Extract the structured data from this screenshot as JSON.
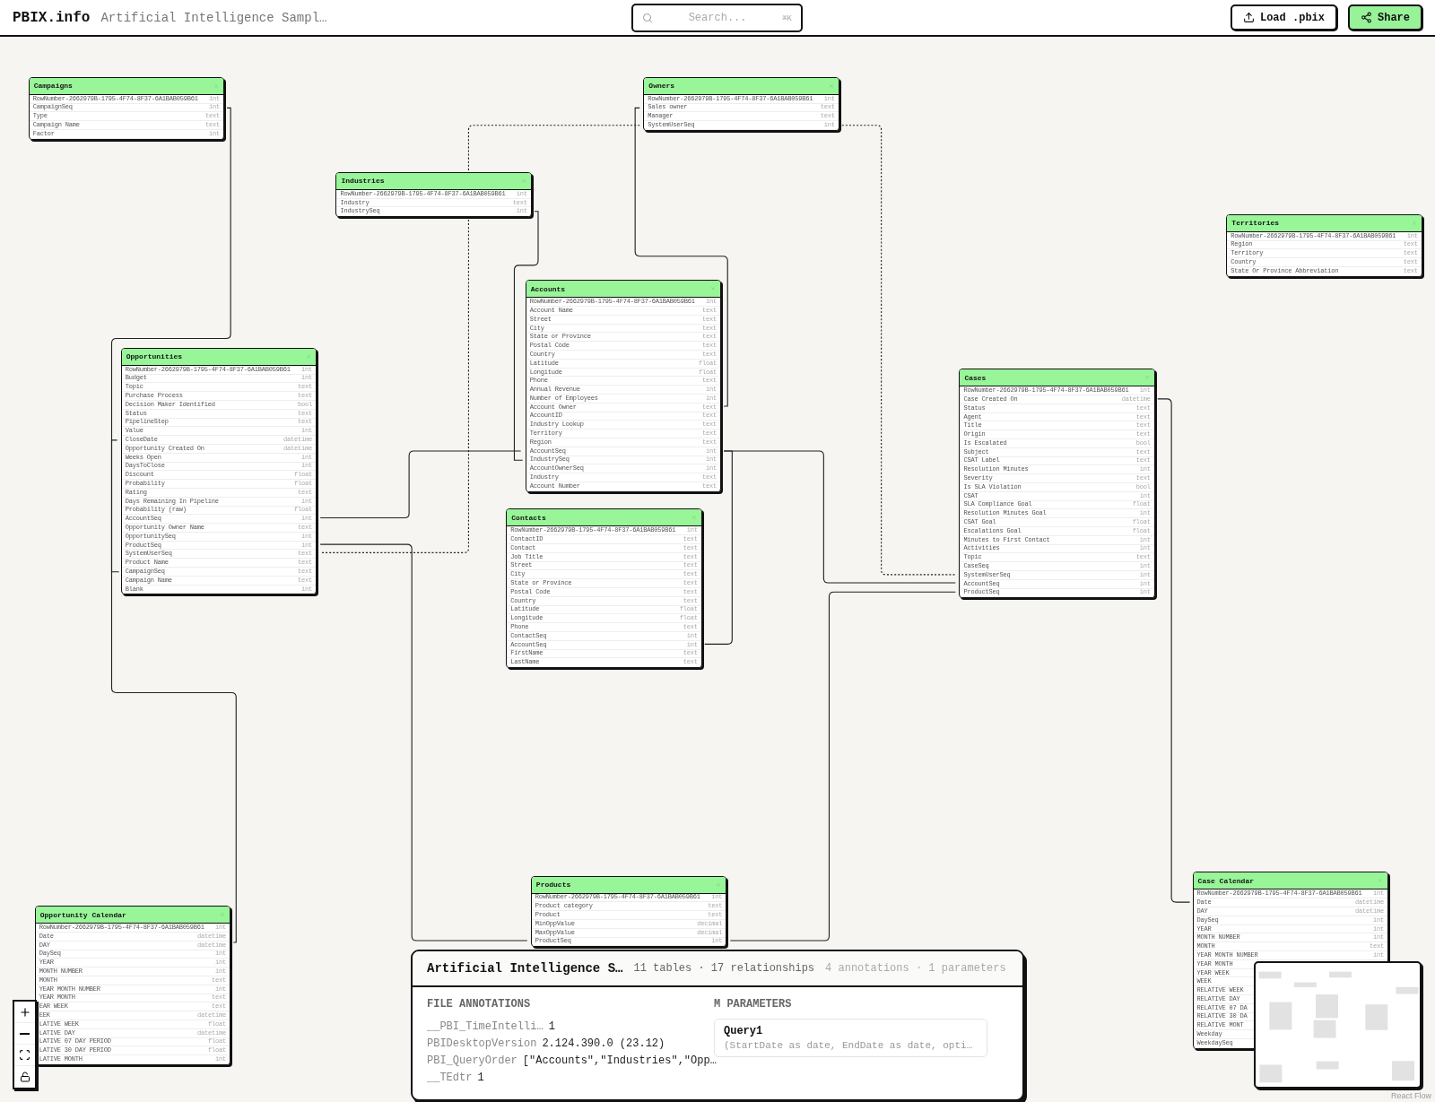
{
  "header": {
    "logo": "PBIX.info",
    "subtitle": "Artificial Intelligence Sampl…",
    "search": {
      "placeholder": "Search...",
      "shortcut": "⌘K"
    },
    "buttons": [
      {
        "label": "Load .pbix",
        "kind": "upload"
      },
      {
        "label": "Share",
        "kind": "share"
      }
    ]
  },
  "tables": [
    {
      "name": "Campaigns",
      "columns": [
        {
          "name": "RowNumber-2662979B-1795-4F74-8F37-6A1BAB059B61",
          "type": "int"
        },
        {
          "name": "CampaignSeq",
          "type": "int"
        },
        {
          "name": "Type",
          "type": "text"
        },
        {
          "name": "Campaign Name",
          "type": "text"
        },
        {
          "name": "Factor",
          "type": "int"
        }
      ]
    },
    {
      "name": "Owners",
      "columns": [
        {
          "name": "RowNumber-2662979B-1795-4F74-8F37-6A1BAB059B61",
          "type": "int"
        },
        {
          "name": "Sales owner",
          "type": "text"
        },
        {
          "name": "Manager",
          "type": "text"
        },
        {
          "name": "SystemUserSeq",
          "type": "int"
        }
      ]
    },
    {
      "name": "Industries",
      "columns": [
        {
          "name": "RowNumber-2662979B-1795-4F74-8F37-6A1BAB059B61",
          "type": "int"
        },
        {
          "name": "Industry",
          "type": "text"
        },
        {
          "name": "IndustrySeq",
          "type": "int"
        }
      ]
    },
    {
      "name": "Territories",
      "columns": [
        {
          "name": "RowNumber-2662979B-1795-4F74-8F37-6A1BAB059B61",
          "type": "int"
        },
        {
          "name": "Region",
          "type": "text"
        },
        {
          "name": "Territory",
          "type": "text"
        },
        {
          "name": "Country",
          "type": "text"
        },
        {
          "name": "State Or Province Abbreviation",
          "type": "text"
        }
      ]
    },
    {
      "name": "Accounts",
      "columns": [
        {
          "name": "RowNumber-2662979B-1795-4F74-8F37-6A1BAB059B61",
          "type": "int"
        },
        {
          "name": "Account Name",
          "type": "text"
        },
        {
          "name": "Street",
          "type": "text"
        },
        {
          "name": "City",
          "type": "text"
        },
        {
          "name": "State or Province",
          "type": "text"
        },
        {
          "name": "Postal Code",
          "type": "text"
        },
        {
          "name": "Country",
          "type": "text"
        },
        {
          "name": "Latitude",
          "type": "float"
        },
        {
          "name": "Longitude",
          "type": "float"
        },
        {
          "name": "Phone",
          "type": "text"
        },
        {
          "name": "Annual Revenue",
          "type": "int"
        },
        {
          "name": "Number of Employees",
          "type": "int"
        },
        {
          "name": "Account Owner",
          "type": "text"
        },
        {
          "name": "AccountID",
          "type": "text"
        },
        {
          "name": "Industry Lookup",
          "type": "text"
        },
        {
          "name": "Territory",
          "type": "text"
        },
        {
          "name": "Region",
          "type": "text"
        },
        {
          "name": "AccountSeq",
          "type": "int"
        },
        {
          "name": "IndustrySeq",
          "type": "int"
        },
        {
          "name": "AccountOwnerSeq",
          "type": "int"
        },
        {
          "name": "Industry",
          "type": "text"
        },
        {
          "name": "Account Number",
          "type": "text"
        }
      ]
    },
    {
      "name": "Opportunities",
      "columns": [
        {
          "name": "RowNumber-2662979B-1795-4F74-8F37-6A1BAB059B61",
          "type": "int"
        },
        {
          "name": "Budget",
          "type": "int"
        },
        {
          "name": "Topic",
          "type": "text"
        },
        {
          "name": "Purchase Process",
          "type": "text"
        },
        {
          "name": "Decision Maker Identified",
          "type": "bool"
        },
        {
          "name": "Status",
          "type": "text"
        },
        {
          "name": "PipelineStep",
          "type": "text"
        },
        {
          "name": "Value",
          "type": "int"
        },
        {
          "name": "CloseDate",
          "type": "datetime"
        },
        {
          "name": "Opportunity Created On",
          "type": "datetime"
        },
        {
          "name": "Weeks Open",
          "type": "int"
        },
        {
          "name": "DaysToClose",
          "type": "int"
        },
        {
          "name": "Discount",
          "type": "float"
        },
        {
          "name": "Probability",
          "type": "float"
        },
        {
          "name": "Rating",
          "type": "text"
        },
        {
          "name": "Days Remaining In Pipeline",
          "type": "int"
        },
        {
          "name": "Probability (raw)",
          "type": "float"
        },
        {
          "name": "AccountSeq",
          "type": "int"
        },
        {
          "name": "Opportunity Owner Name",
          "type": "text"
        },
        {
          "name": "OpportunitySeq",
          "type": "int"
        },
        {
          "name": "ProductSeq",
          "type": "int"
        },
        {
          "name": "SystemUserSeq",
          "type": "text"
        },
        {
          "name": "Product Name",
          "type": "text"
        },
        {
          "name": "CampaignSeq",
          "type": "text"
        },
        {
          "name": "Campaign Name",
          "type": "text"
        },
        {
          "name": "Blank",
          "type": "int"
        }
      ]
    },
    {
      "name": "Cases",
      "columns": [
        {
          "name": "RowNumber-2662979B-1795-4F74-8F37-6A1BAB059B61",
          "type": "int"
        },
        {
          "name": "Case Created On",
          "type": "datetime"
        },
        {
          "name": "Status",
          "type": "text"
        },
        {
          "name": "Agent",
          "type": "text"
        },
        {
          "name": "Title",
          "type": "text"
        },
        {
          "name": "Origin",
          "type": "text"
        },
        {
          "name": "Is Escalated",
          "type": "bool"
        },
        {
          "name": "Subject",
          "type": "text"
        },
        {
          "name": "CSAT Label",
          "type": "text"
        },
        {
          "name": "Resolution Minutes",
          "type": "int"
        },
        {
          "name": "Severity",
          "type": "text"
        },
        {
          "name": "Is SLA Violation",
          "type": "bool"
        },
        {
          "name": "CSAT",
          "type": "int"
        },
        {
          "name": "SLA Compliance Goal",
          "type": "float"
        },
        {
          "name": "Resolution Minutes Goal",
          "type": "int"
        },
        {
          "name": "CSAT Goal",
          "type": "float"
        },
        {
          "name": "Escalations Goal",
          "type": "float"
        },
        {
          "name": "Minutes to First Contact",
          "type": "int"
        },
        {
          "name": "Activities",
          "type": "int"
        },
        {
          "name": "Topic",
          "type": "text"
        },
        {
          "name": "CaseSeq",
          "type": "int"
        },
        {
          "name": "SystemUserSeq",
          "type": "int"
        },
        {
          "name": "AccountSeq",
          "type": "int"
        },
        {
          "name": "ProductSeq",
          "type": "int"
        }
      ]
    },
    {
      "name": "Contacts",
      "columns": [
        {
          "name": "RowNumber-2662979B-1795-4F74-8F37-6A1BAB059B61",
          "type": "int"
        },
        {
          "name": "ContactID",
          "type": "text"
        },
        {
          "name": "Contact",
          "type": "text"
        },
        {
          "name": "Job Title",
          "type": "text"
        },
        {
          "name": "Street",
          "type": "text"
        },
        {
          "name": "City",
          "type": "text"
        },
        {
          "name": "State or Province",
          "type": "text"
        },
        {
          "name": "Postal Code",
          "type": "text"
        },
        {
          "name": "Country",
          "type": "text"
        },
        {
          "name": "Latitude",
          "type": "float"
        },
        {
          "name": "Longitude",
          "type": "float"
        },
        {
          "name": "Phone",
          "type": "text"
        },
        {
          "name": "ContactSeq",
          "type": "int"
        },
        {
          "name": "AccountSeq",
          "type": "int"
        },
        {
          "name": "FirstName",
          "type": "text"
        },
        {
          "name": "LastName",
          "type": "text"
        }
      ]
    },
    {
      "name": "Products",
      "columns": [
        {
          "name": "RowNumber-2662979B-1795-4F74-8F37-6A1BAB059B61",
          "type": "int"
        },
        {
          "name": "Product category",
          "type": "text"
        },
        {
          "name": "Product",
          "type": "text"
        },
        {
          "name": "MinOppValue",
          "type": "decimal"
        },
        {
          "name": "MaxOppValue",
          "type": "decimal"
        },
        {
          "name": "ProductSeq",
          "type": "int"
        }
      ]
    },
    {
      "name": "Opportunity Calendar",
      "columns": [
        {
          "name": "RowNumber-2662979B-1795-4F74-8F37-6A1BAB059B61",
          "type": "int"
        },
        {
          "name": "Date",
          "type": "datetime"
        },
        {
          "name": "DAY",
          "type": "datetime"
        },
        {
          "name": "DaySeq",
          "type": "int"
        },
        {
          "name": "YEAR",
          "type": "int"
        },
        {
          "name": "MONTH NUMBER",
          "type": "int"
        },
        {
          "name": "MONTH",
          "type": "text"
        },
        {
          "name": "YEAR MONTH NUMBER",
          "type": "int"
        },
        {
          "name": "YEAR MONTH",
          "type": "text"
        },
        {
          "name": "EAR WEEK",
          "type": "text"
        },
        {
          "name": "EEK",
          "type": "datetime"
        },
        {
          "name": "LATIVE WEEK",
          "type": "float"
        },
        {
          "name": "LATIVE DAY",
          "type": "datetime"
        },
        {
          "name": "LATIVE 07 DAY PERIOD",
          "type": "float"
        },
        {
          "name": "LATIVE 30 DAY PERIOD",
          "type": "float"
        },
        {
          "name": "LATIVE MONTH",
          "type": "int"
        }
      ]
    },
    {
      "name": "Case Calendar",
      "columns": [
        {
          "name": "RowNumber-2662979B-1795-4F74-8F37-6A1BAB059B61",
          "type": "int"
        },
        {
          "name": "Date",
          "type": "datetime"
        },
        {
          "name": "DAY",
          "type": "datetime"
        },
        {
          "name": "DaySeq",
          "type": "int"
        },
        {
          "name": "YEAR",
          "type": "int"
        },
        {
          "name": "MONTH NUMBER",
          "type": "int"
        },
        {
          "name": "MONTH",
          "type": "text"
        },
        {
          "name": "YEAR MONTH NUMBER",
          "type": "int"
        },
        {
          "name": "YEAR MONTH"
        },
        {
          "name": "YEAR WEEK"
        },
        {
          "name": "WEEK"
        },
        {
          "name": "RELATIVE WEEK"
        },
        {
          "name": "RELATIVE DAY"
        },
        {
          "name": "RELATIVE 07 DA"
        },
        {
          "name": "RELATIVE 30 DA"
        },
        {
          "name": "RELATIVE MONT"
        },
        {
          "name": "Weekday"
        },
        {
          "name": "WeekdaySeq"
        }
      ]
    }
  ],
  "summary": {
    "title": "Artificial Intelligence S…",
    "stats": "11 tables · 17 relationships",
    "stats_muted": "4 annotations · 1 parameters",
    "annotations_heading": "FILE ANNOTATIONS",
    "annotations": [
      {
        "key": "__PBI_TimeIntelli…",
        "value": "1"
      },
      {
        "key": "PBIDesktopVersion",
        "value": "2.124.390.0 (23.12)"
      },
      {
        "key": "PBI_QueryOrder",
        "value": "[\"Accounts\",\"Industries\",\"Opp…"
      },
      {
        "key": "__TEdtr",
        "value": "1"
      }
    ],
    "parameters_heading": "M PARAMETERS",
    "parameters": [
      {
        "name": "Query1",
        "value": "(StartDate as date, EndDate as date, opti…"
      }
    ]
  },
  "attribution": "React Flow"
}
